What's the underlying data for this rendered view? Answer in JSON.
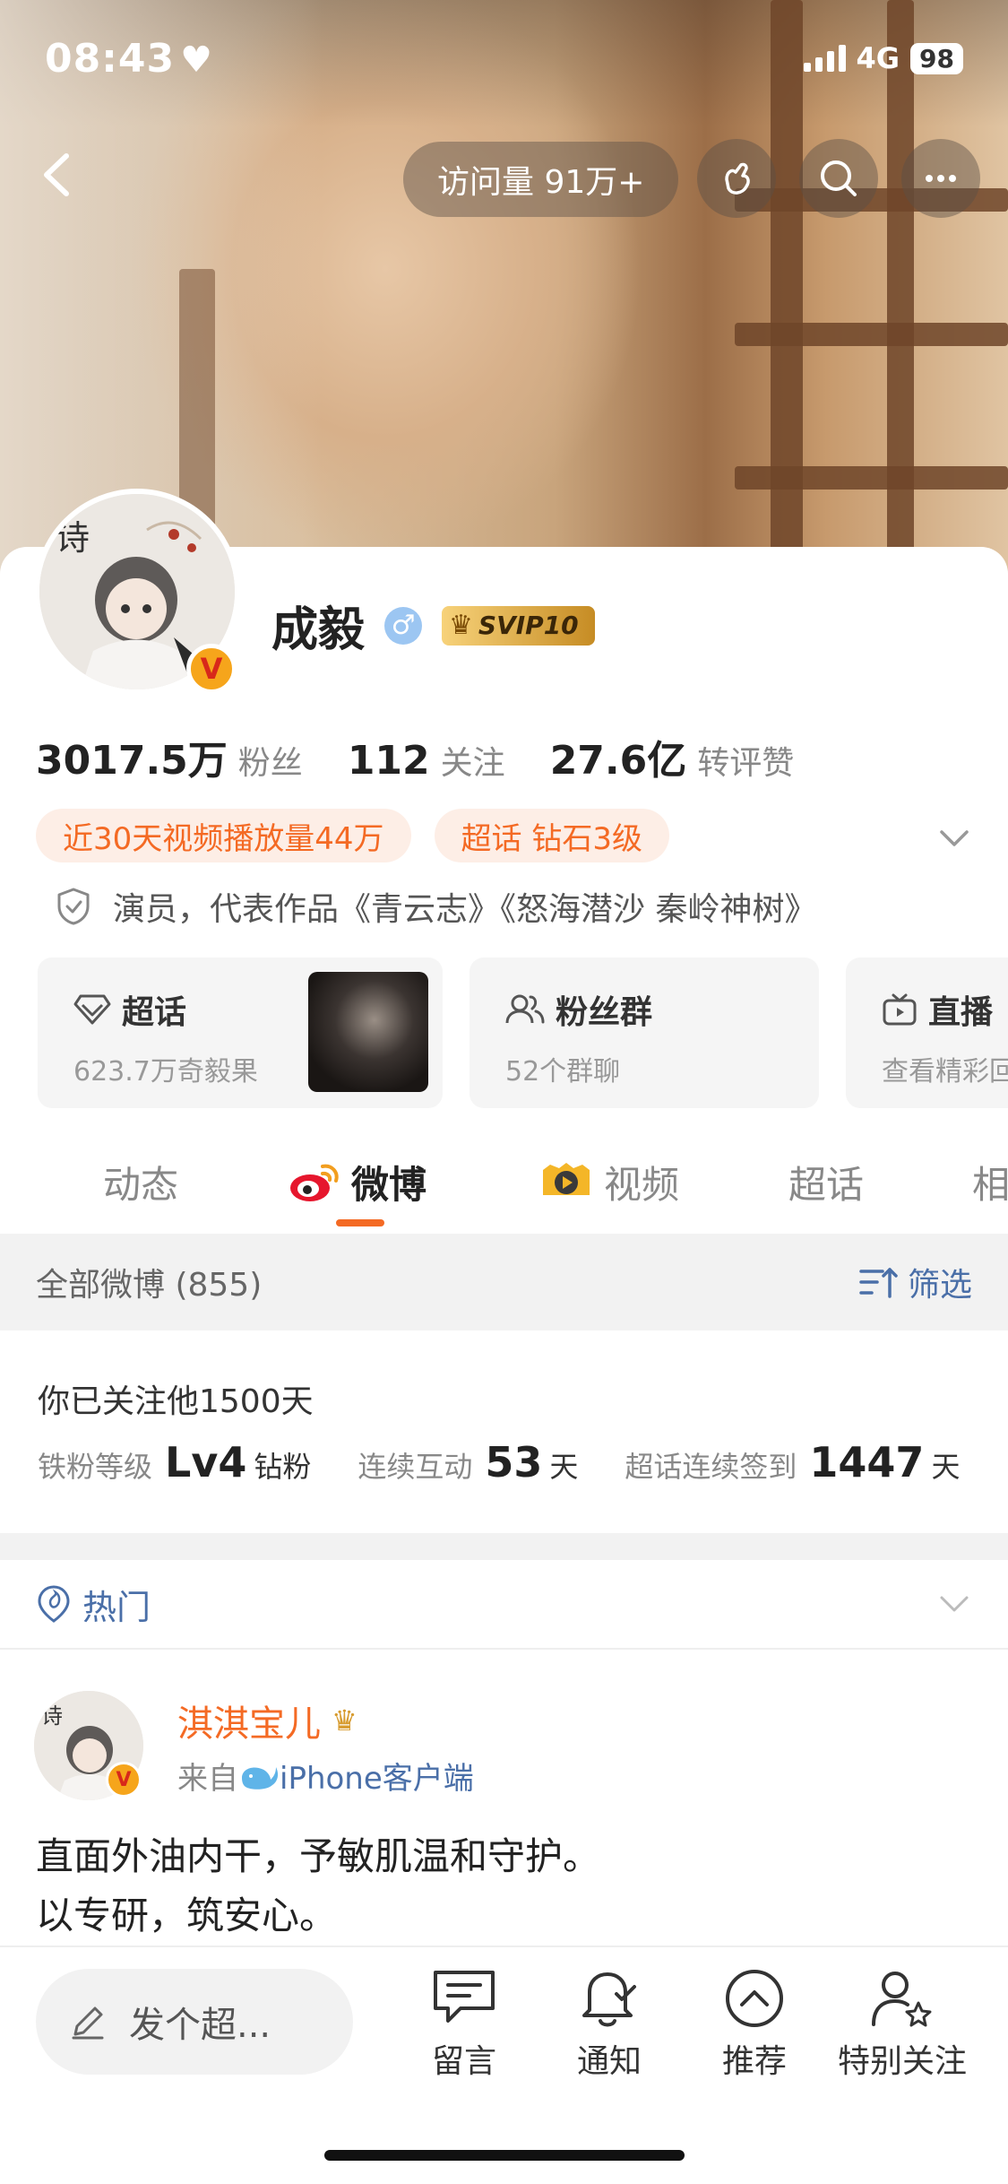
{
  "status_bar": {
    "time": "08:43",
    "network": "4G",
    "battery": "98"
  },
  "header": {
    "visits": "访问量 91万+"
  },
  "profile": {
    "name": "成毅",
    "vip_label": "SVIP10",
    "stats": [
      {
        "value": "3017.5万",
        "label": "粉丝"
      },
      {
        "value": "112",
        "label": "关注"
      },
      {
        "value": "27.6亿",
        "label": "转评赞"
      }
    ],
    "chips": [
      "近30天视频播放量44万",
      "超话 钻石3级"
    ],
    "bio": "演员，代表作品《青云志》《怒海潜沙 秦岭神树》"
  },
  "features": [
    {
      "title": "超话",
      "sub": "623.7万奇毅果"
    },
    {
      "title": "粉丝群",
      "sub": "52个群聊"
    },
    {
      "title": "直播",
      "sub": "查看精彩回放"
    }
  ],
  "tabs": [
    "动态",
    "微博",
    "视频",
    "超话",
    "相册"
  ],
  "feed": {
    "all_label": "全部微博 (855)",
    "filter_label": "筛选"
  },
  "follow_info": {
    "days_text": "你已关注他1500天",
    "fan_level_label": "铁粉等级",
    "fan_level_value": "Lv4",
    "fan_level_unit": "钻粉",
    "interact_label": "连续互动",
    "interact_value": "53",
    "interact_unit": "天",
    "checkin_label": "超话连续签到",
    "checkin_value": "1447",
    "checkin_unit": "天"
  },
  "hot_section": {
    "label": "热门"
  },
  "post": {
    "author": "淇淇宝儿",
    "source_prefix": "来自",
    "source_client": "iPhone客户端",
    "text_line1": "直面外油内干，予敏肌温和守护。",
    "text_line2": "以专研，筑安心。"
  },
  "bottom_bar": {
    "compose_placeholder": "发个超...",
    "items": [
      "留言",
      "通知",
      "推荐",
      "特别关注"
    ]
  },
  "colors": {
    "accent": "#f46a24",
    "link": "#4a6fa8",
    "chip_bg": "#fdeee6"
  }
}
